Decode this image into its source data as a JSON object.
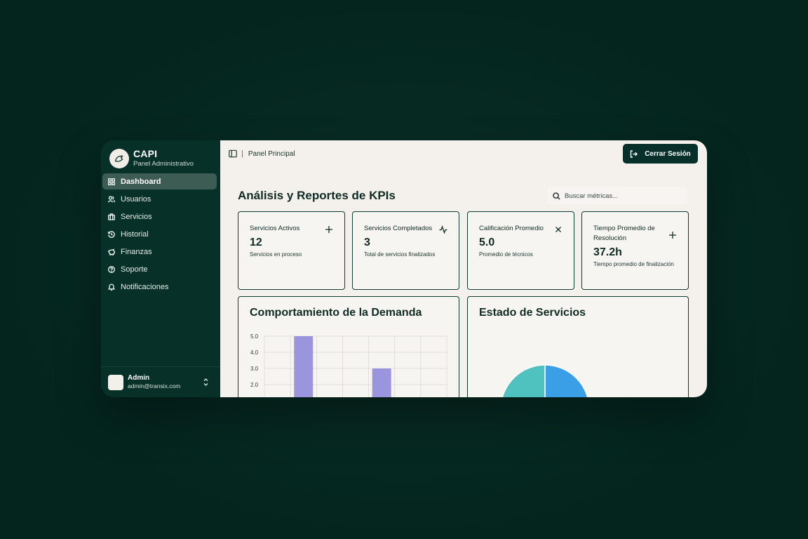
{
  "brand": {
    "name": "CAPI",
    "subtitle": "Panel Administrativo"
  },
  "sidebar": {
    "items": [
      {
        "label": "Dashboard",
        "icon": "grid-icon",
        "active": true
      },
      {
        "label": "Usuarios",
        "icon": "users-icon"
      },
      {
        "label": "Servicios",
        "icon": "briefcase-icon"
      },
      {
        "label": "Historial",
        "icon": "history-icon"
      },
      {
        "label": "Finanzas",
        "icon": "piggy-bank-icon"
      },
      {
        "label": "Soporte",
        "icon": "help-circle-icon"
      },
      {
        "label": "Notificaciones",
        "icon": "bell-icon"
      }
    ],
    "user": {
      "name": "Admin",
      "email": "admin@transix.com"
    }
  },
  "topbar": {
    "breadcrumb": "Panel Principal",
    "logout_label": "Cerrar Sesión"
  },
  "main": {
    "heading": "Análisis y Reportes de KPIs",
    "search_placeholder": "Buscar métricas..."
  },
  "kpis": [
    {
      "label": "Servicios Activos",
      "value": "12",
      "desc": "Servicios en proceso",
      "icon": "plus-icon"
    },
    {
      "label": "Servicios Completados",
      "value": "3",
      "desc": "Total de servicios finalizados",
      "icon": "activity-icon"
    },
    {
      "label": "Calificación Promedio",
      "value": "5.0",
      "desc": "Promedio de técnicos",
      "icon": "x-icon"
    },
    {
      "label": "Tiempo Promedio de Resolución",
      "value": "37.2h",
      "desc": "Tiempo promedio de finalización",
      "icon": "plus-icon"
    }
  ],
  "colors": {
    "bar": "#9b95dd",
    "pie_blue": "#3b9fe8",
    "pie_teal": "#4fc1bf"
  },
  "chart_data": [
    {
      "type": "bar",
      "title": "Comportamiento de la Demanda",
      "y_ticks": [
        "5.0",
        "4.0",
        "3.0",
        "2.0"
      ],
      "categories": [
        "",
        "",
        "",
        "",
        "",
        "",
        ""
      ],
      "values": [
        0,
        5,
        0,
        0,
        3,
        0,
        0
      ],
      "ylim": [
        0,
        5
      ],
      "grid": true
    },
    {
      "type": "pie",
      "title": "Estado de Servicios",
      "slices": [
        {
          "value": 50,
          "color": "#3b9fe8"
        },
        {
          "value": 50,
          "color": "#4fc1bf"
        }
      ]
    }
  ]
}
